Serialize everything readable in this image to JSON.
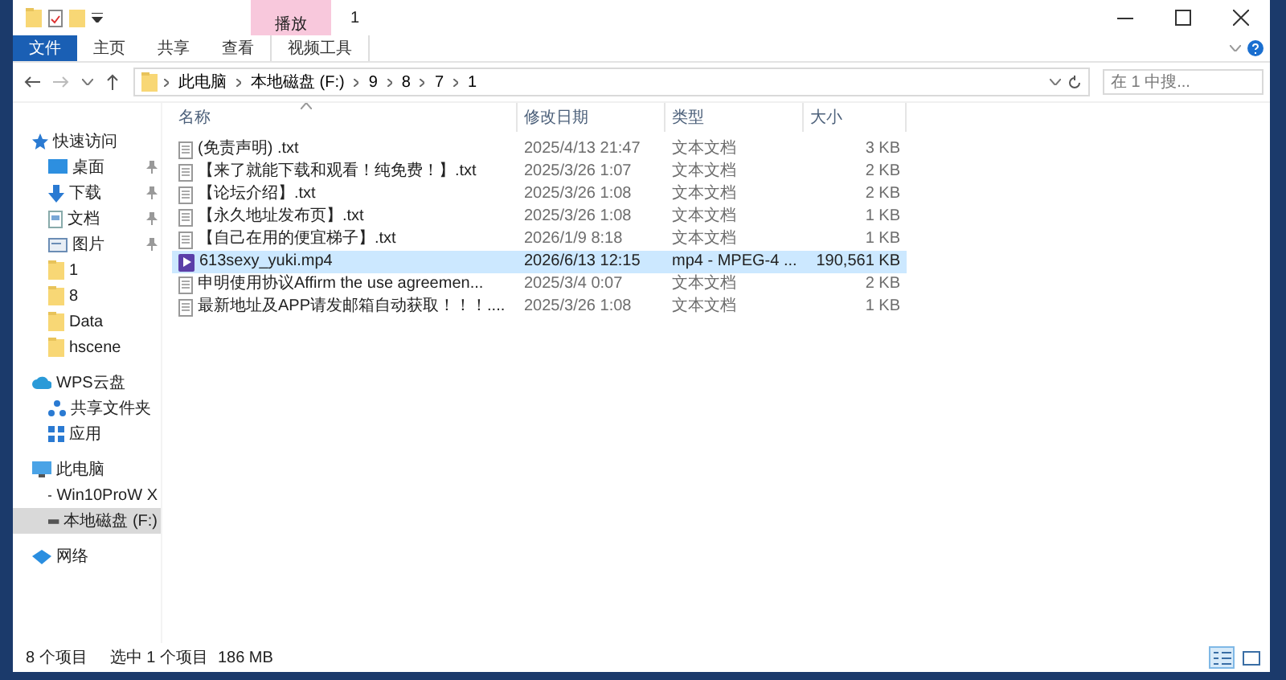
{
  "window": {
    "title": "1"
  },
  "ribbon": {
    "context_group": "播放",
    "tabs": [
      {
        "label": "文件",
        "kind": "file",
        "selected": false
      },
      {
        "label": "主页",
        "kind": "plain",
        "selected": false
      },
      {
        "label": "共享",
        "kind": "plain",
        "selected": false
      },
      {
        "label": "查看",
        "kind": "plain",
        "selected": false
      },
      {
        "label": "视频工具",
        "kind": "context",
        "selected": false
      }
    ]
  },
  "address": {
    "path": [
      "此电脑",
      "本地磁盘 (F:)",
      "9",
      "8",
      "7",
      "1"
    ],
    "search": {
      "placeholder": "在 1 中搜..."
    }
  },
  "sidebar": {
    "items": [
      {
        "label": "快速访问",
        "kind": "star",
        "children": [
          {
            "label": "桌面",
            "kind": "desktop",
            "pinned": true
          },
          {
            "label": "下载",
            "kind": "download",
            "pinned": true
          },
          {
            "label": "文档",
            "kind": "document",
            "pinned": true
          },
          {
            "label": "图片",
            "kind": "picture",
            "pinned": true
          },
          {
            "label": "1",
            "kind": "folder",
            "pinned": false
          },
          {
            "label": "8",
            "kind": "folder",
            "pinned": false
          },
          {
            "label": "Data",
            "kind": "folder",
            "pinned": false
          },
          {
            "label": "hscene",
            "kind": "folder",
            "pinned": false
          }
        ]
      },
      {
        "label": "WPS云盘",
        "kind": "cloud",
        "children": [
          {
            "label": "共享文件夹",
            "kind": "share",
            "pinned": false
          },
          {
            "label": "应用",
            "kind": "apps",
            "pinned": false
          }
        ]
      },
      {
        "label": "此电脑",
        "kind": "pc",
        "children": [
          {
            "label": "Win10ProW X",
            "kind": "drive",
            "pinned": false,
            "selected": false
          },
          {
            "label": "本地磁盘 (F:)",
            "kind": "drive",
            "pinned": false,
            "selected": true
          }
        ]
      },
      {
        "label": "网络",
        "kind": "network"
      }
    ]
  },
  "table": {
    "columns": [
      "名称",
      "修改日期",
      "类型",
      "大小"
    ],
    "rows": [
      {
        "kind": "text",
        "name": "(免责声明) .txt",
        "date": "2025/4/13 21:47",
        "type": "文本文档",
        "size": "3 KB",
        "selected": false
      },
      {
        "kind": "text",
        "name": "【来了就能下载和观看！纯免费！】.txt",
        "date": "2025/3/26 1:07",
        "type": "文本文档",
        "size": "2 KB",
        "selected": false
      },
      {
        "kind": "text",
        "name": "【论坛介绍】.txt",
        "date": "2025/3/26 1:08",
        "type": "文本文档",
        "size": "2 KB",
        "selected": false
      },
      {
        "kind": "text",
        "name": "【永久地址发布页】.txt",
        "date": "2025/3/26 1:08",
        "type": "文本文档",
        "size": "1 KB",
        "selected": false
      },
      {
        "kind": "text",
        "name": "【自己在用的便宜梯子】.txt",
        "date": "2026/1/9 8:18",
        "type": "文本文档",
        "size": "1 KB",
        "selected": false
      },
      {
        "kind": "video",
        "name": "613sexy_yuki.mp4",
        "date": "2026/6/13 12:15",
        "type": "mp4 - MPEG-4 ...",
        "size": "190,561 KB",
        "selected": true
      },
      {
        "kind": "text",
        "name": "申明使用协议Affirm the use agreemen...",
        "date": "2025/3/4 0:07",
        "type": "文本文档",
        "size": "2 KB",
        "selected": false
      },
      {
        "kind": "text",
        "name": "最新地址及APP请发邮箱自动获取！！！....",
        "date": "2025/3/26 1:08",
        "type": "文本文档",
        "size": "1 KB",
        "selected": false
      }
    ]
  },
  "status_bar": {
    "count": "8 个项目",
    "selection": "选中 1 个项目",
    "size": "186 MB",
    "views": [
      {
        "kind": "details",
        "selected": true
      },
      {
        "kind": "thumbnails",
        "selected": false
      }
    ]
  }
}
